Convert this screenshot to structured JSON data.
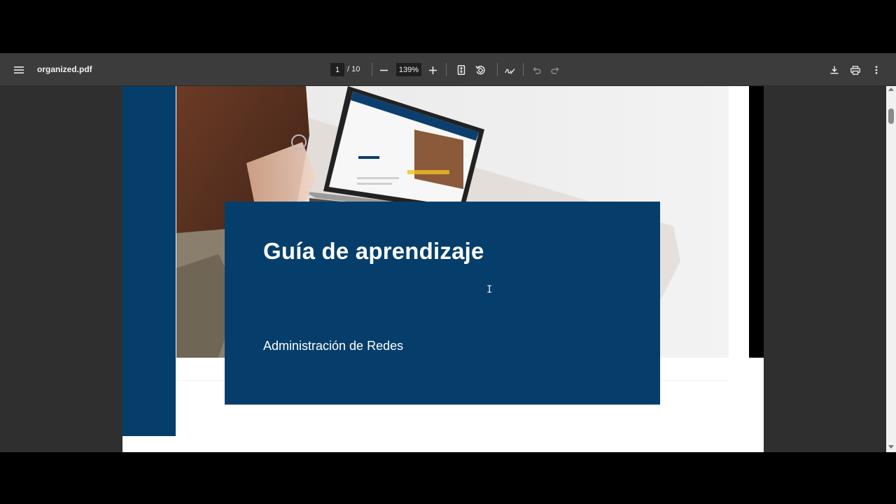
{
  "toolbar": {
    "file_name": "organized.pdf",
    "current_page": "1",
    "page_total": "/ 10",
    "zoom": "139%"
  },
  "document": {
    "heading": "Guía de aprendizaje",
    "subtitle": "Administración de Redes"
  },
  "colors": {
    "toolbar_bg": "#3c3c3c",
    "viewer_bg": "#2f2f2f",
    "brand_blue": "#053e6b",
    "page_bg": "#ffffff"
  },
  "icons": {
    "menu": "menu-icon",
    "zoom_out": "minus-icon",
    "zoom_in": "plus-icon",
    "fit": "fit-page-icon",
    "rotate": "rotate-icon",
    "annotate": "pen-icon",
    "undo": "undo-icon",
    "redo": "redo-icon",
    "download": "download-icon",
    "print": "print-icon",
    "more": "more-vert-icon"
  }
}
